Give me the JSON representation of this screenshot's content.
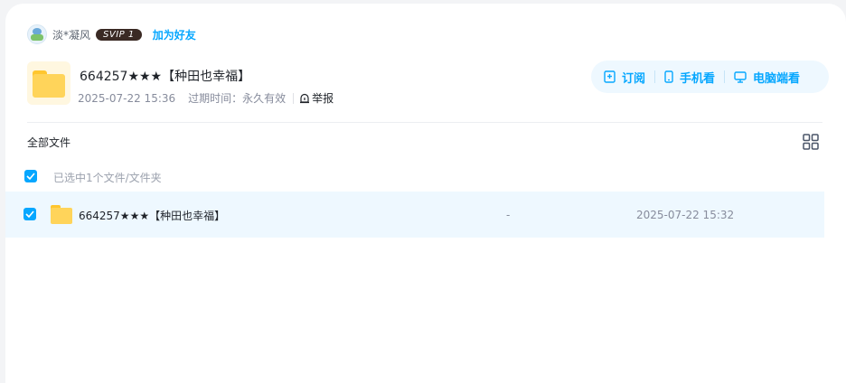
{
  "user": {
    "name": "淡*凝风",
    "vip_badge": "SVIP 1",
    "add_friend_label": "加为好友"
  },
  "share": {
    "title": "664257★★★【种田也幸福】",
    "created": "2025-07-22 15:36",
    "expiry_label": "过期时间：",
    "expiry_value": "永久有效",
    "report_label": "举报"
  },
  "actions": {
    "subscribe_label": "订阅",
    "mobile_label": "手机看",
    "pc_label": "电脑端看"
  },
  "list": {
    "breadcrumb": "全部文件",
    "selected_text": "已选中1个文件/文件夹",
    "files": [
      {
        "name": "664257★★★【种田也幸福】",
        "size": "-",
        "date": "2025-07-22 15:32",
        "selected": true
      }
    ]
  },
  "colors": {
    "accent": "#06a7ff",
    "row_highlight": "#eef8ff",
    "folder": "#ffd45a"
  },
  "icons": [
    "avatar",
    "folder-icon",
    "report-icon",
    "bookmark-icon",
    "phone-icon",
    "monitor-icon",
    "grid-view-icon",
    "check-icon"
  ]
}
